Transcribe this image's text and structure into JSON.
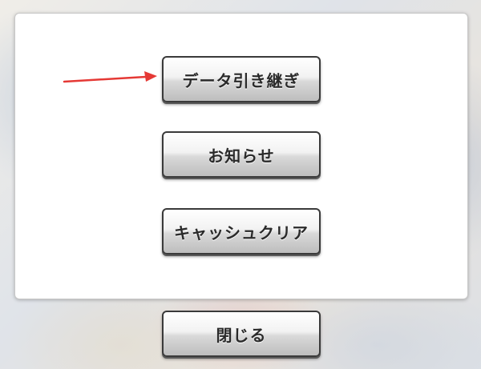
{
  "menu": {
    "data_transfer_label": "データ引き継ぎ",
    "news_label": "お知らせ",
    "cache_clear_label": "キャッシュクリア"
  },
  "footer": {
    "close_label": "閉じる"
  },
  "colors": {
    "arrow": "#e53935",
    "panel_bg": "#ffffff",
    "button_border": "#3a3a3a",
    "button_text": "#2a2a2a"
  },
  "icons": {
    "pointer": "red-arrow-icon"
  }
}
